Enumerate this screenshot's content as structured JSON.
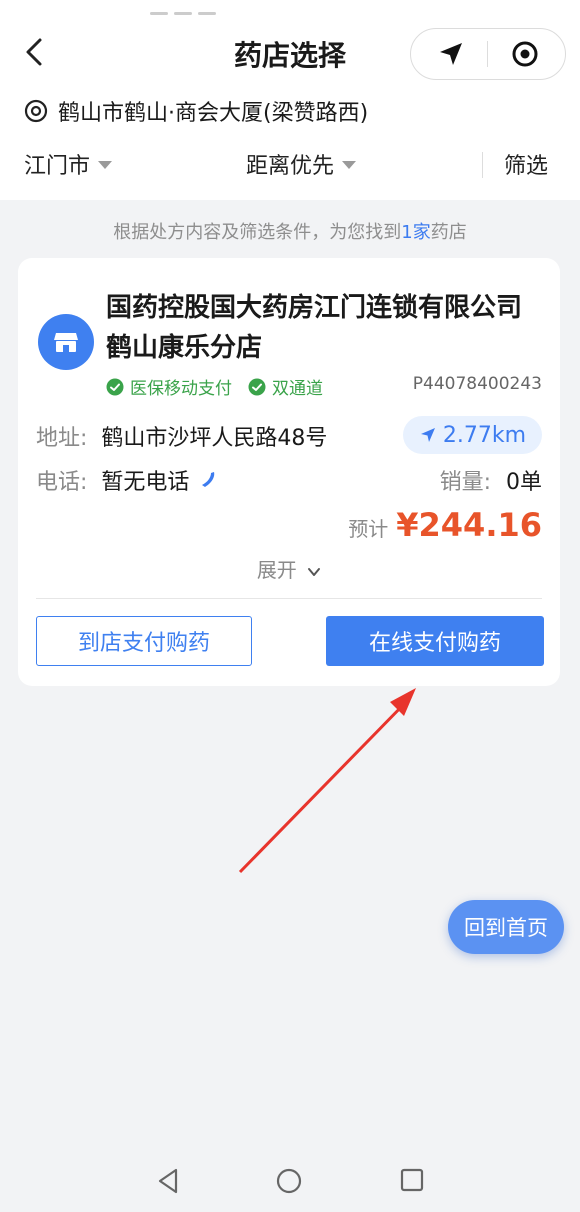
{
  "header": {
    "title": "药店选择",
    "location": "鹤山市鹤山·商会大厦(梁赞路西)"
  },
  "filters": {
    "city": "江门市",
    "sort": "距离优先",
    "screen": "筛选"
  },
  "summary": {
    "prefix": "根据处方内容及筛选条件，为您找到",
    "count": "1家",
    "suffix": "药店"
  },
  "pharmacy": {
    "name": "国药控股国大药房江门连锁有限公司鹤山康乐分店",
    "tags": [
      "医保移动支付",
      "双通道"
    ],
    "license": "P44078400243",
    "address_label": "地址:",
    "address": "鹤山市沙坪人民路48号",
    "distance": "2.77km",
    "phone_label": "电话:",
    "phone": "暂无电话",
    "sales_label": "销量:",
    "sales": "0单",
    "price_label": "预计",
    "price": "¥244.16",
    "expand": "展开"
  },
  "actions": {
    "in_store": "到店支付购药",
    "online": "在线支付购药"
  },
  "float_button": "回到首页",
  "colors": {
    "accent": "#3f80f0",
    "price": "#e8542a",
    "tag_green": "#3aa34a",
    "annotation_arrow": "#e8342c"
  },
  "icons": [
    "back-icon",
    "location-arrow-icon",
    "target-icon",
    "pin-icon",
    "store-icon",
    "check-icon",
    "phone-icon",
    "chevron-down-icon"
  ]
}
